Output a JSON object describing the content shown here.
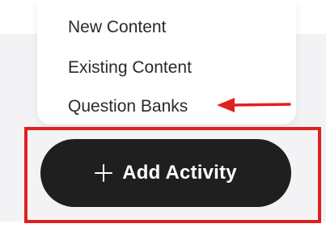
{
  "menu": {
    "items": [
      {
        "label": "New Content"
      },
      {
        "label": "Existing Content"
      },
      {
        "label": "Question Banks"
      }
    ]
  },
  "button": {
    "label": "Add Activity",
    "icon": "plus-icon"
  },
  "colors": {
    "annotation_red": "#e02020",
    "button_bg": "#1f1f1f",
    "button_text": "#ffffff",
    "menu_bg": "#ffffff",
    "page_band": "#f3f3f5"
  }
}
